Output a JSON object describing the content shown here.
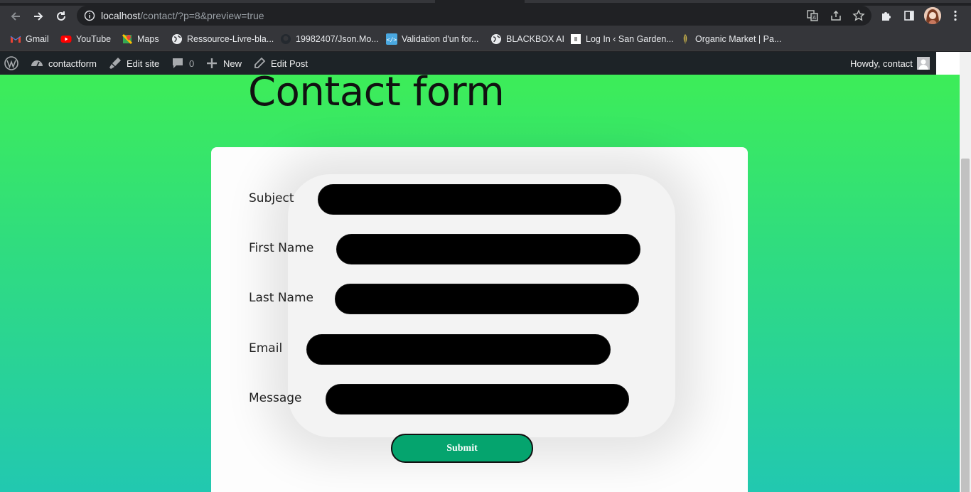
{
  "browser": {
    "url_host": "localhost",
    "url_path": "/contact/?p=8&preview=true",
    "bookmarks": [
      {
        "label": "Gmail",
        "icon": "gmail-icon"
      },
      {
        "label": "YouTube",
        "icon": "youtube-icon"
      },
      {
        "label": "Maps",
        "icon": "maps-icon"
      },
      {
        "label": "Ressource-Livre-bla...",
        "icon": "globe-icon"
      },
      {
        "label": "19982407/Json.Mo...",
        "icon": "github-icon"
      },
      {
        "label": "Validation d'un for...",
        "icon": "code-icon"
      },
      {
        "label": "BLACKBOX AI",
        "icon": "globe-icon"
      },
      {
        "label": "Log In ‹ San Garden...",
        "icon": "page-icon"
      },
      {
        "label": "Organic Market | Pa...",
        "icon": "leaf-icon"
      }
    ]
  },
  "adminbar": {
    "site_name": "contactform",
    "edit_site": "Edit site",
    "comments_count": "0",
    "new_label": "New",
    "edit_post": "Edit Post",
    "howdy": "Howdy, contact"
  },
  "page": {
    "title": "Contact form",
    "fields": [
      {
        "label": "Subject"
      },
      {
        "label": "First Name"
      },
      {
        "label": "Last Name"
      },
      {
        "label": "Email"
      },
      {
        "label": "Message"
      }
    ],
    "submit_label": "Submit"
  },
  "colors": {
    "gradient_top": "#3ded58",
    "gradient_bottom": "#22c8b0",
    "submit_bg": "#05a46e"
  }
}
